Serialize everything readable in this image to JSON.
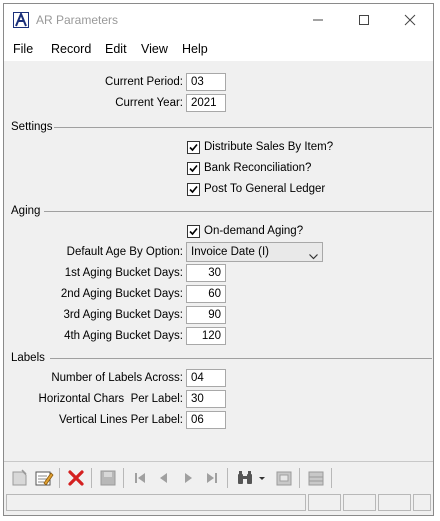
{
  "window": {
    "title": "AR Parameters"
  },
  "menu": {
    "items": [
      "File",
      "Record",
      "Edit",
      "View",
      "Help"
    ]
  },
  "period": {
    "current_period_label": "Current Period:",
    "current_period_value": "03",
    "current_year_label": "Current Year:",
    "current_year_value": "2021"
  },
  "settings": {
    "title": "Settings",
    "distribute_sales": {
      "label": "Distribute Sales By Item?",
      "checked": true
    },
    "bank_reconciliation": {
      "label": "Bank Reconciliation?",
      "checked": true
    },
    "post_to_gl": {
      "label": "Post To General Ledger",
      "checked": true
    }
  },
  "aging": {
    "title": "Aging",
    "on_demand": {
      "label": "On-demand Aging?",
      "checked": true
    },
    "default_age_label": "Default Age By Option:",
    "default_age_value": "Invoice Date (I)",
    "bucket1_label": "1st Aging Bucket Days:",
    "bucket1_value": "30",
    "bucket2_label": "2nd Aging Bucket Days:",
    "bucket2_value": "60",
    "bucket3_label": "3rd Aging Bucket Days:",
    "bucket3_value": "90",
    "bucket4_label": "4th Aging Bucket Days:",
    "bucket4_value": "120"
  },
  "labels": {
    "title": "Labels",
    "across_label": "Number of Labels Across:",
    "across_value": "04",
    "horizontal_label": "Horizontal Chars  Per Label:",
    "horizontal_value": "30",
    "vertical_label": "Vertical Lines Per Label:",
    "vertical_value": "06"
  },
  "colors": {
    "accent_blue": "#1a2f7a",
    "delete_red": "#d42020",
    "disabled_gray": "#a0a0a0"
  }
}
